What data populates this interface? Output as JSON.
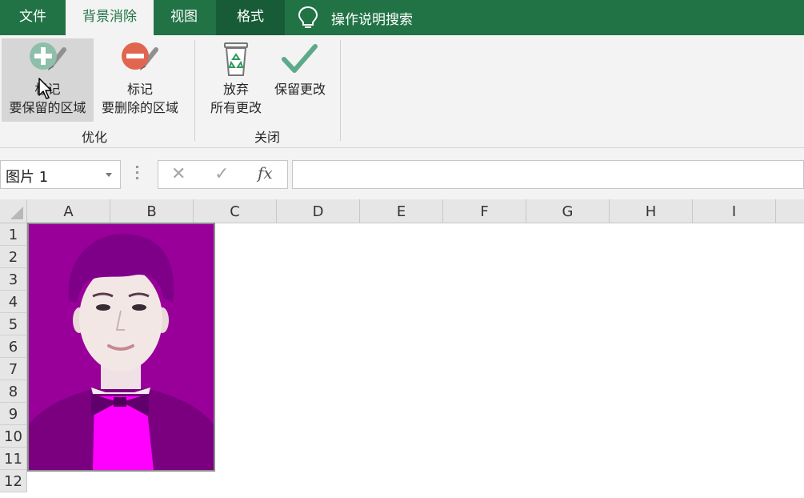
{
  "tabs": [
    {
      "label": "文件"
    },
    {
      "label": "背景消除"
    },
    {
      "label": "视图"
    },
    {
      "label": "格式"
    }
  ],
  "tell_me": "操作说明搜索",
  "ribbon": {
    "keep": {
      "line1": "标记",
      "line2": "要保留的区域",
      "icon": "mark-keep-icon"
    },
    "remove": {
      "line1": "标记",
      "line2": "要删除的区域",
      "icon": "mark-remove-icon"
    },
    "discard": {
      "line1": "放弃",
      "line2": "所有更改",
      "icon": "recycle-bin-icon"
    },
    "keep_changes": {
      "line1": "保留更改",
      "icon": "checkmark-icon"
    },
    "groups": {
      "refine": "优化",
      "close": "关闭"
    }
  },
  "formula_bar": {
    "name_box": "图片 1",
    "cancel": "✕",
    "enter": "✓",
    "fx": "fx",
    "value": ""
  },
  "grid": {
    "columns": [
      "A",
      "B",
      "C",
      "D",
      "E",
      "F",
      "G",
      "H",
      "I"
    ],
    "rows": [
      "1",
      "2",
      "3",
      "4",
      "5",
      "6",
      "7",
      "8",
      "9",
      "10",
      "11",
      "12"
    ]
  },
  "colors": {
    "ribbon_green": "#217346",
    "background_removal_magenta": "#990099",
    "kept_highlight": "#ff00ff"
  }
}
